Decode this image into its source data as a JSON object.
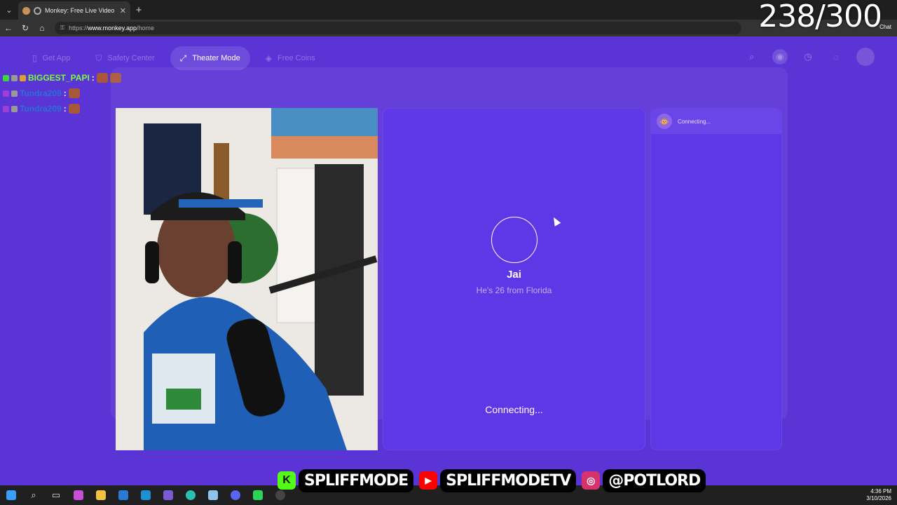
{
  "counter": "238/300",
  "browser": {
    "tab_title": "Monkey: Free Live Video Chat",
    "tab_close": "✕",
    "new_tab": "+",
    "url_prefix": "https://",
    "url_host": "www.monkey.app",
    "url_path": "/home",
    "chat_label": "Chat"
  },
  "nav": {
    "get_app": "Get App",
    "safety_center": "Safety Center",
    "theater_mode": "Theater Mode",
    "free_coins": "Free Coins"
  },
  "chat_overlay": [
    {
      "user": "BIGGEST_PAPI",
      "sep": ":"
    },
    {
      "user": "Tundra209",
      "sep": ":"
    },
    {
      "user": "Tundra209",
      "sep": ":"
    }
  ],
  "partner": {
    "name": "Jai",
    "description": "He's 26 from Florida",
    "status": "Connecting..."
  },
  "chat_panel": {
    "status": "Connecting..."
  },
  "socials": {
    "kick": "SPLIFFMODE",
    "youtube": "SPLIFFMODETV",
    "instagram": "@POTLORD"
  },
  "clock": {
    "time": "4:36 PM",
    "date": "3/10/2026"
  },
  "icons": {
    "theater": "expand-icon",
    "search": "search-icon",
    "history": "clock-icon",
    "messages": "chat-icon"
  }
}
